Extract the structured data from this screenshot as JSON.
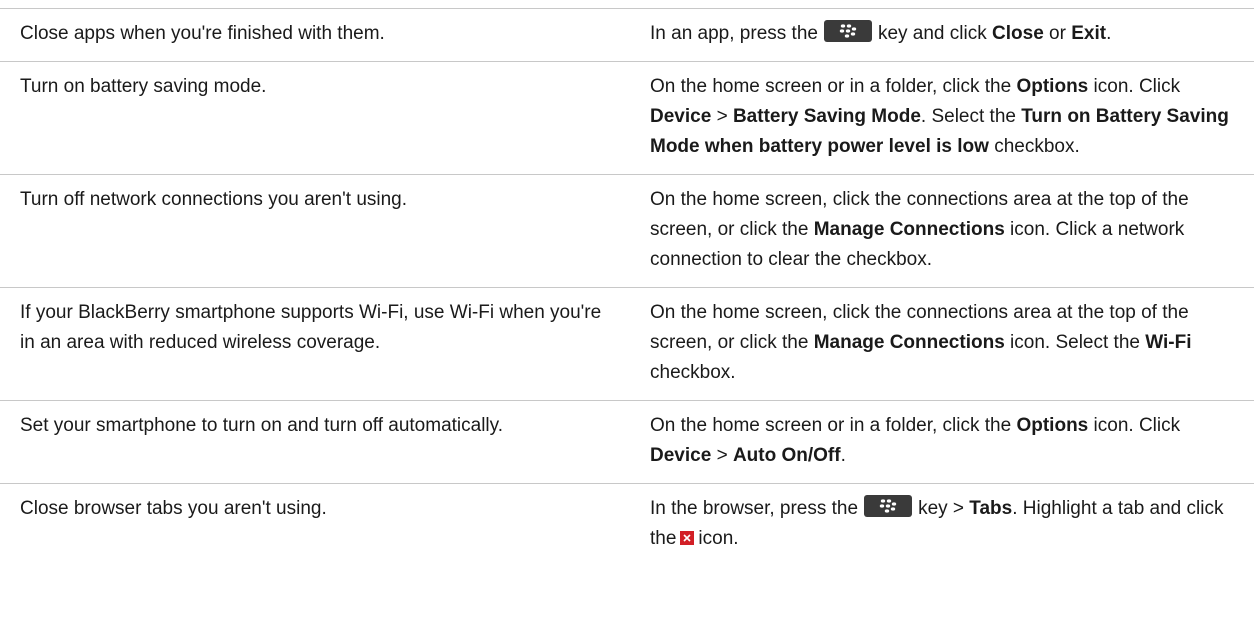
{
  "rows": [
    {
      "tip": "Close apps when you're finished with them.",
      "how": {
        "a": "In an app, press the",
        "b": "key and click",
        "c": "Close",
        "d": "or",
        "e": "Exit",
        "f": "."
      }
    },
    {
      "tip": "Turn on battery saving mode.",
      "how": {
        "a": "On the home screen or in a folder, click the",
        "b": "Options",
        "c": "icon. Click",
        "d": "Device",
        "e": ">",
        "f": "Battery Saving Mode",
        "g": ". Select the",
        "h": "Turn on Battery Saving Mode when battery power level is low",
        "i": "checkbox."
      }
    },
    {
      "tip": "Turn off network connections you aren't using.",
      "how": {
        "a": "On the home screen, click the connections area at the top of the screen, or click the",
        "b": "Manage Connections",
        "c": "icon. Click a network connection to clear the checkbox."
      }
    },
    {
      "tip": "If your BlackBerry smartphone supports Wi-Fi, use Wi-Fi when you're in an area with reduced wireless coverage.",
      "how": {
        "a": "On the home screen, click the connections area at the top of the screen, or click the",
        "b": "Manage Connections",
        "c": "icon. Select the",
        "d": "Wi-Fi",
        "e": "checkbox."
      }
    },
    {
      "tip": "Set your smartphone to turn on and turn off automatically.",
      "how": {
        "a": "On the home screen or in a folder, click the",
        "b": "Options",
        "c": "icon. Click",
        "d": "Device",
        "e": ">",
        "f": "Auto On/Off",
        "g": "."
      }
    },
    {
      "tip": "Close browser tabs you aren't using.",
      "how": {
        "a": "In the browser, press the",
        "b": "key >",
        "c": "Tabs",
        "d": ". Highlight a tab and click the",
        "e": "icon."
      }
    }
  ],
  "icons": {
    "menu_key": "blackberry-menu-key-icon",
    "close_x": "close-x-icon"
  },
  "colors": {
    "menu_key_bg": "#3a3a3a",
    "close_x_bg": "#d21f26",
    "divider": "#c8c8c8"
  }
}
